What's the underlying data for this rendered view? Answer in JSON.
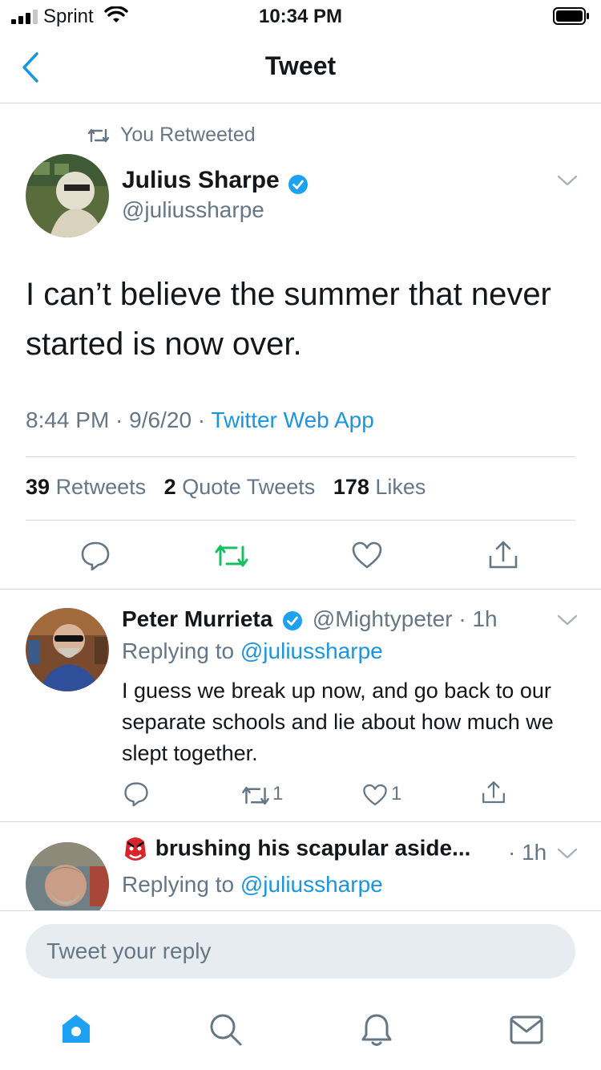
{
  "status_bar": {
    "carrier": "Sprint",
    "time": "10:34 PM"
  },
  "nav": {
    "title": "Tweet"
  },
  "main_tweet": {
    "retweet_label": "You Retweeted",
    "author": {
      "name": "Julius Sharpe",
      "handle": "@juliussharpe"
    },
    "text": "I can’t believe the summer that never started is now over.",
    "time": "8:44 PM",
    "date": "9/6/20",
    "source": "Twitter Web App",
    "retweets": "39",
    "retweets_label": "Retweets",
    "quotes": "2",
    "quotes_label": "Quote Tweets",
    "likes": "178",
    "likes_label": "Likes"
  },
  "replies": [
    {
      "name": "Peter Murrieta",
      "handle": "@Mightypeter",
      "age": "1h",
      "replying_prefix": "Replying to",
      "replying_to": "@juliussharpe",
      "text": "I guess we break up now, and go back to our separate schools and lie about how much we slept together.",
      "retweet_count": "1",
      "like_count": "1"
    },
    {
      "name": "brushing his scapular aside...",
      "age": "1h",
      "replying_prefix": "Replying to",
      "replying_to": "@juliussharpe"
    }
  ],
  "reply_input": {
    "placeholder": "Tweet your reply"
  },
  "colors": {
    "accent": "#1b95e0",
    "retweet_green": "#17bf63",
    "gray": "#657786"
  }
}
